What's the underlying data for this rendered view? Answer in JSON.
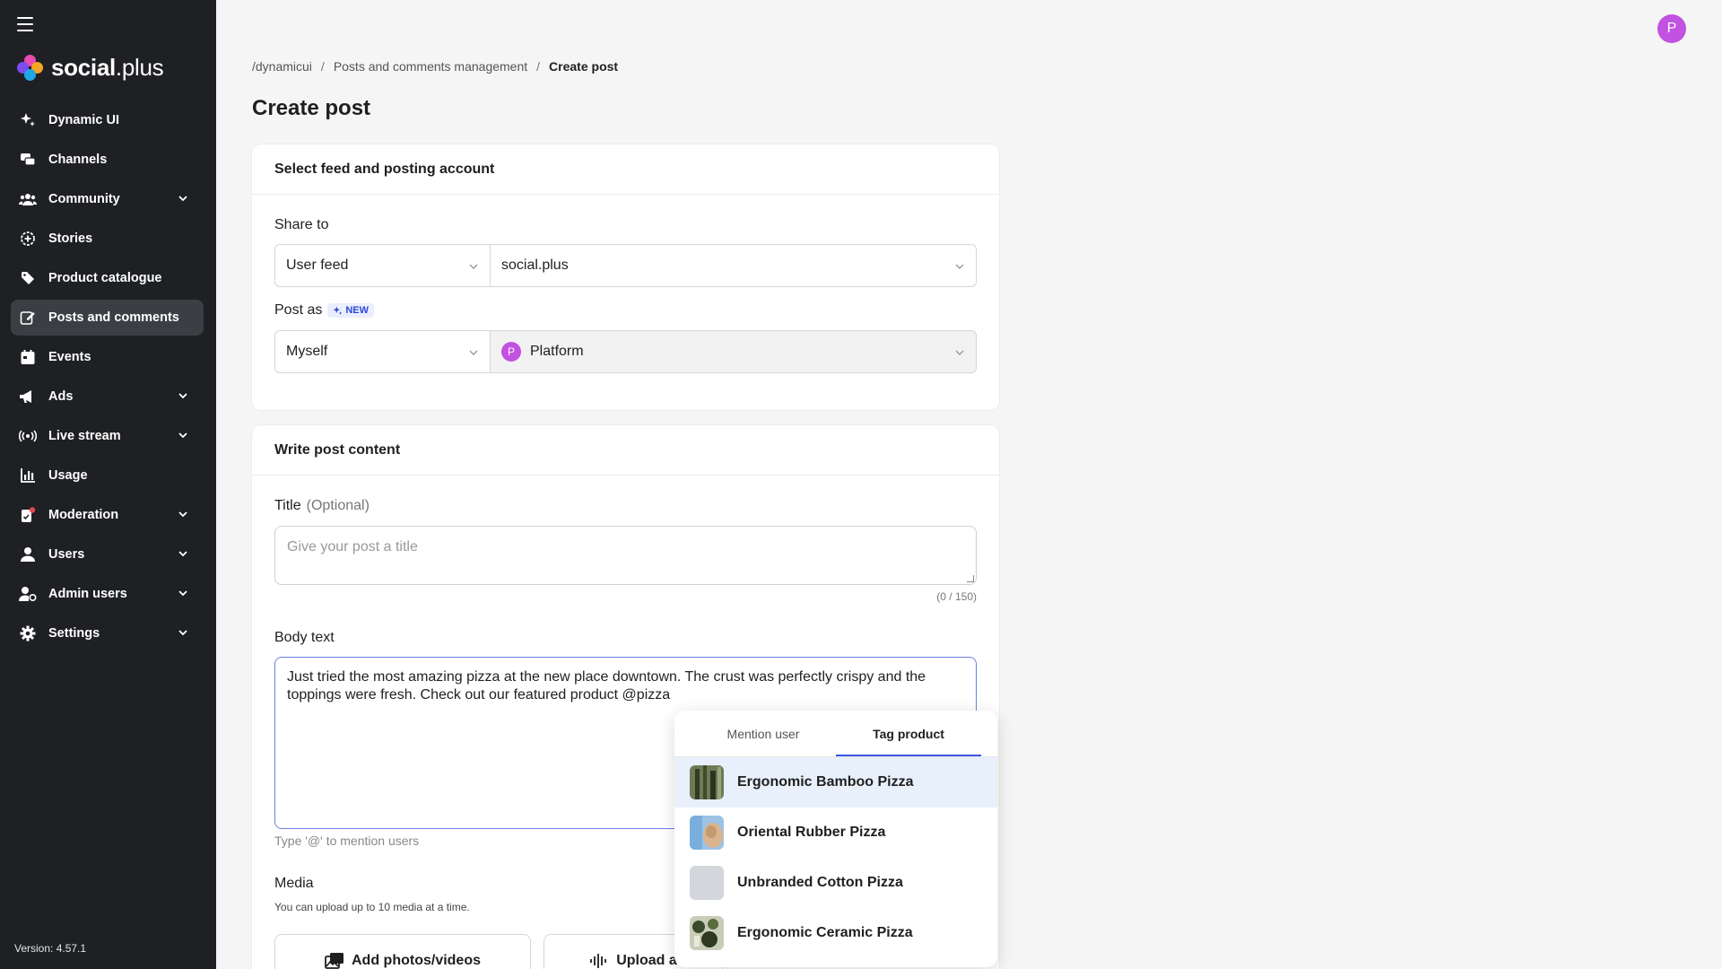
{
  "app": {
    "logo_text_bold": "social",
    "logo_text_light": ".plus",
    "version": "Version: 4.57.1",
    "user_initial": "P"
  },
  "sidebar": {
    "items": [
      {
        "label": "Dynamic UI",
        "icon": "sparkles-icon",
        "chevron": false
      },
      {
        "label": "Channels",
        "icon": "chat-bubbles-icon",
        "chevron": false
      },
      {
        "label": "Community",
        "icon": "group-icon",
        "chevron": true
      },
      {
        "label": "Stories",
        "icon": "stories-icon",
        "chevron": false
      },
      {
        "label": "Product catalogue",
        "icon": "tag-icon",
        "chevron": false
      },
      {
        "label": "Posts and comments",
        "icon": "edit-icon",
        "chevron": false,
        "active": true
      },
      {
        "label": "Events",
        "icon": "calendar-icon",
        "chevron": false
      },
      {
        "label": "Ads",
        "icon": "megaphone-icon",
        "chevron": true
      },
      {
        "label": "Live stream",
        "icon": "broadcast-icon",
        "chevron": true
      },
      {
        "label": "Usage",
        "icon": "bar-chart-icon",
        "chevron": false
      },
      {
        "label": "Moderation",
        "icon": "moderation-icon",
        "chevron": true
      },
      {
        "label": "Users",
        "icon": "user-icon",
        "chevron": true
      },
      {
        "label": "Admin users",
        "icon": "admin-user-icon",
        "chevron": true
      },
      {
        "label": "Settings",
        "icon": "gear-icon",
        "chevron": true
      }
    ]
  },
  "breadcrumb": {
    "root": "/dynamicui",
    "parent": "Posts and comments management",
    "current": "Create post",
    "separator": "/"
  },
  "page": {
    "title": "Create post"
  },
  "feed_card": {
    "header": "Select feed and posting account",
    "share_to_label": "Share to",
    "share_to_type": "User feed",
    "share_to_target": "social.plus",
    "post_as_label": "Post as",
    "new_badge": "NEW",
    "post_as_type": "Myself",
    "post_as_account": "Platform",
    "post_as_initial": "P"
  },
  "content_card": {
    "header": "Write post content",
    "title_label": "Title",
    "title_optional": "(Optional)",
    "title_placeholder": "Give your post a title",
    "title_count": "(0 / 150)",
    "body_label": "Body text",
    "body_value": "Just tried the most amazing pizza at the new place downtown. The crust was perfectly crispy and the toppings were fresh. Check out our featured product @pizza",
    "body_hint": "Type '@' to mention users",
    "media_label": "Media",
    "media_sub": "You can upload up to 10 media at a time.",
    "add_media_label": "Add photos/videos",
    "upload_audio_label": "Upload a"
  },
  "mention_dropdown": {
    "tabs": [
      {
        "label": "Mention user",
        "active": false
      },
      {
        "label": "Tag product",
        "active": true
      }
    ],
    "products": [
      {
        "name": "Ergonomic Bamboo Pizza",
        "highlight": true
      },
      {
        "name": "Oriental Rubber Pizza",
        "highlight": false
      },
      {
        "name": "Unbranded Cotton Pizza",
        "highlight": false
      },
      {
        "name": "Ergonomic Ceramic Pizza",
        "highlight": false
      }
    ]
  },
  "colors": {
    "sidebar_bg": "#1e2023",
    "active_item_bg": "#3b3e43",
    "avatar": "#c252e1",
    "accent": "#3b57e6",
    "highlight_row": "#e8f0fc"
  }
}
